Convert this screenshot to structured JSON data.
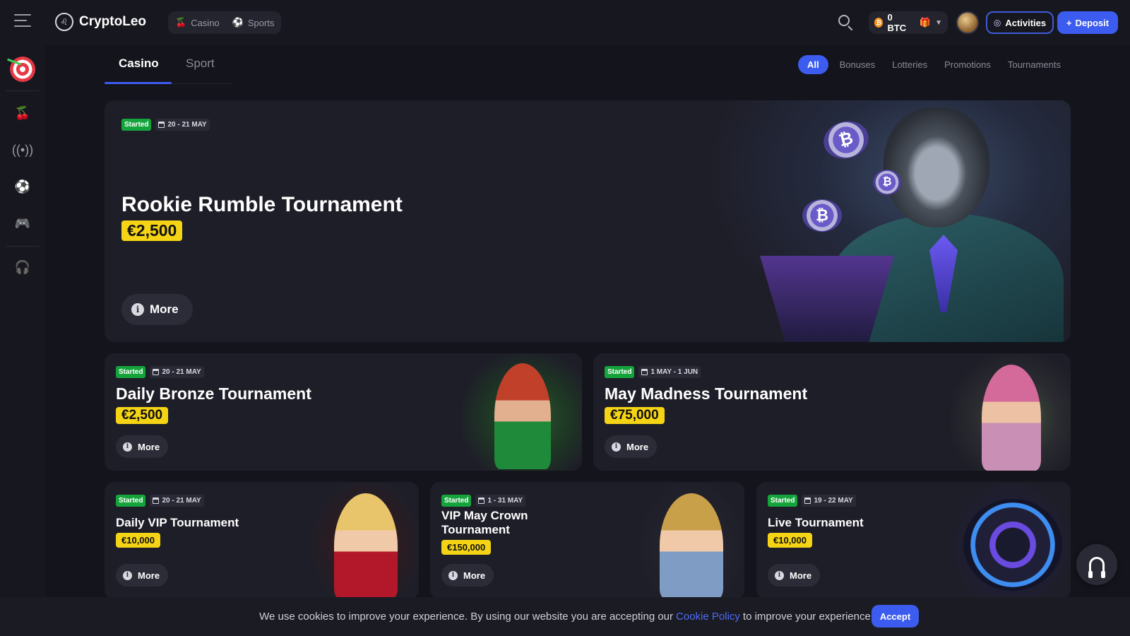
{
  "header": {
    "logo_text": "CryptoLeo",
    "nav": [
      {
        "label": "Casino",
        "icon": "cherries-icon"
      },
      {
        "label": "Sports",
        "icon": "soccer-ball-icon"
      }
    ],
    "balance": "0 BTC",
    "activities_label": "Activities",
    "deposit_label": "Deposit"
  },
  "sidebar": {
    "items": [
      "dart-target-icon",
      "cherries-icon",
      "live-broadcast-icon",
      "soccer-ball-icon",
      "gamepad-icon",
      "support-headset-icon"
    ]
  },
  "tabs": [
    {
      "label": "Casino",
      "active": true
    },
    {
      "label": "Sport",
      "active": false
    }
  ],
  "filters": [
    "All",
    "Bonuses",
    "Lotteries",
    "Promotions",
    "Tournaments"
  ],
  "hero": {
    "status": "Started",
    "date": "20 - 21 MAY",
    "title": "Rookie Rumble Tournament",
    "prize": "€2,500",
    "more": "More"
  },
  "cards_mid": [
    {
      "status": "Started",
      "date": "20 - 21 MAY",
      "title": "Daily Bronze Tournament",
      "prize": "€2,500",
      "more": "More"
    },
    {
      "status": "Started",
      "date": "1 MAY - 1 JUN",
      "title": "May Madness Tournament",
      "prize": "€75,000",
      "more": "More"
    }
  ],
  "cards_bottom": [
    {
      "status": "Started",
      "date": "20 - 21 MAY",
      "title": "Daily VIP Tournament",
      "prize": "€10,000",
      "more": "More"
    },
    {
      "status": "Started",
      "date": "1 - 31 MAY",
      "title": "VIP May Crown Tournament",
      "prize": "€150,000",
      "more": "More"
    },
    {
      "status": "Started",
      "date": "19 - 22 MAY",
      "title": "Live Tournament",
      "prize": "€10,000",
      "more": "More"
    }
  ],
  "cookie": {
    "text_before": "We use cookies to improve your experience. By using our website you are accepting our",
    "link": "Cookie Policy",
    "text_after": "to improve your experience",
    "accept": "Accept"
  },
  "colors": {
    "accent": "#3c5cf0",
    "prize": "#f5d416",
    "started": "#15a43c"
  }
}
